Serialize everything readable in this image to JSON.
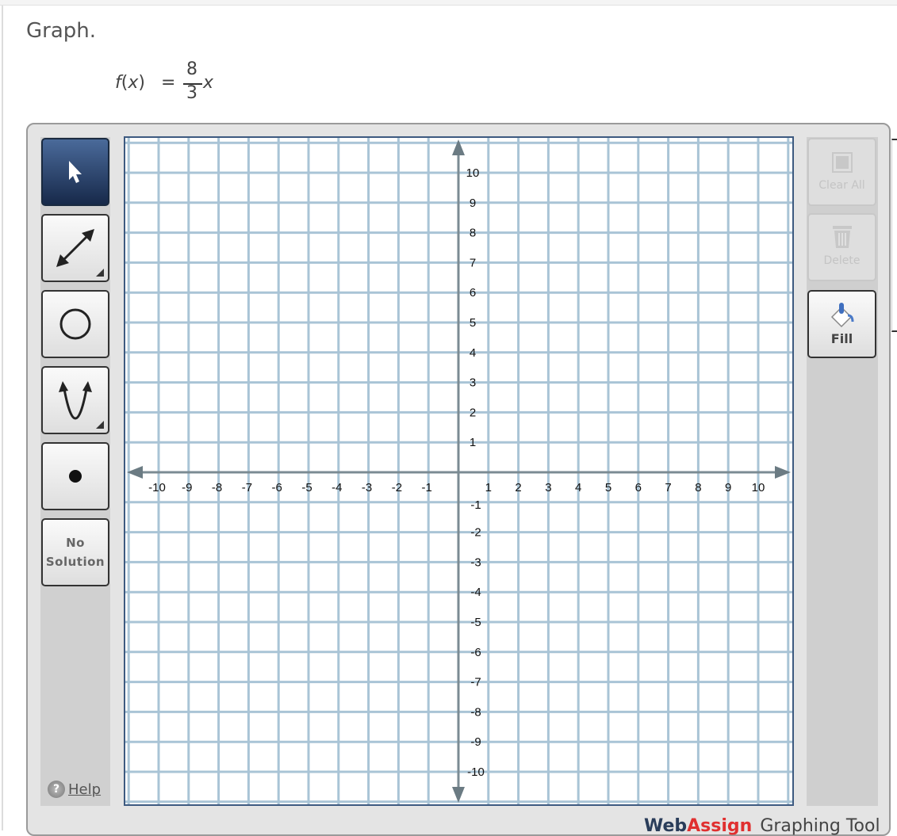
{
  "question": {
    "title": "Graph.",
    "formula": {
      "lhs_func": "f",
      "lhs_var": "x",
      "equals": "=",
      "numerator": "8",
      "denominator": "3",
      "variable": "x"
    }
  },
  "toolbar_left": {
    "tools": [
      {
        "name": "select",
        "icon": "pointer-arrow-icon",
        "active": true
      },
      {
        "name": "line",
        "icon": "double-arrow-line-icon",
        "has_submenu": true
      },
      {
        "name": "circle",
        "icon": "circle-icon"
      },
      {
        "name": "parabola",
        "icon": "parabola-icon",
        "has_submenu": true
      },
      {
        "name": "point",
        "icon": "point-icon"
      },
      {
        "name": "no-solution",
        "label_line1": "No",
        "label_line2": "Solution"
      }
    ],
    "help_label": "Help"
  },
  "toolbar_right": {
    "clear_all_label": "Clear All",
    "delete_label": "Delete",
    "fill_label": "Fill"
  },
  "graph": {
    "x_ticks": [
      "-10",
      "-9",
      "-8",
      "-7",
      "-6",
      "-5",
      "-4",
      "-3",
      "-2",
      "-1",
      "1",
      "2",
      "3",
      "4",
      "5",
      "6",
      "7",
      "8",
      "9",
      "10"
    ],
    "y_ticks": [
      "10",
      "9",
      "8",
      "7",
      "6",
      "5",
      "4",
      "3",
      "2",
      "1",
      "-1",
      "-2",
      "-3",
      "-4",
      "-5",
      "-6",
      "-7",
      "-8",
      "-9",
      "-10"
    ],
    "xmin": -10,
    "xmax": 10,
    "ymin": -10,
    "ymax": 10
  },
  "footer": {
    "brand_part1": "Web",
    "brand_part2": "Assign",
    "product": "Graphing Tool"
  }
}
